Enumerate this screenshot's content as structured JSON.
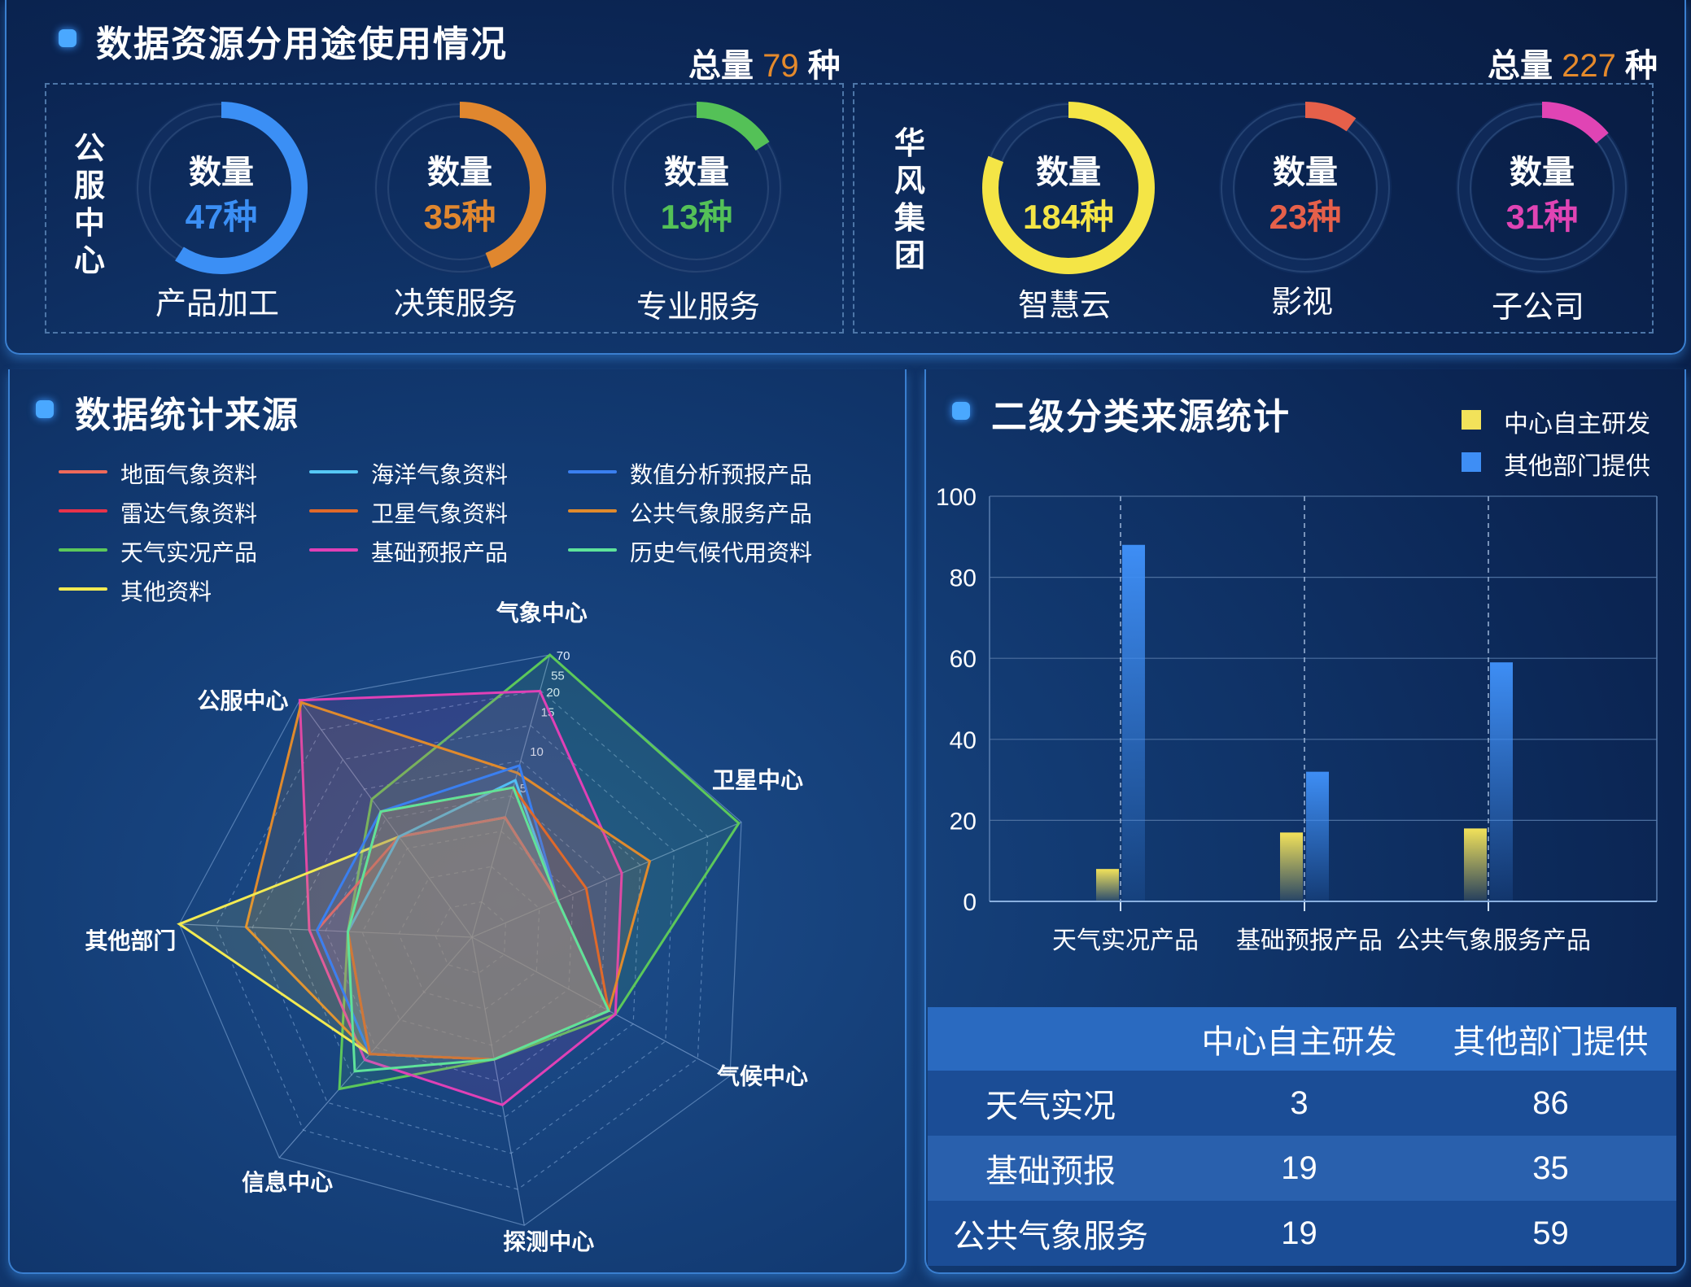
{
  "top": {
    "title": "数据资源分用途使用情况",
    "groups": [
      {
        "name": "公服中心",
        "total_label": "总量",
        "total_value": "79",
        "total_unit": "种",
        "items": [
          {
            "caption": "数量",
            "value": "47种",
            "name": "产品加工",
            "color": "#3b8ff5",
            "fraction": 0.59
          },
          {
            "caption": "数量",
            "value": "35种",
            "name": "决策服务",
            "color": "#e0872f",
            "fraction": 0.44
          },
          {
            "caption": "数量",
            "value": "13种",
            "name": "专业服务",
            "color": "#54c157",
            "fraction": 0.16
          }
        ]
      },
      {
        "name": "华风集团",
        "total_label": "总量",
        "total_value": "227",
        "total_unit": "种",
        "items": [
          {
            "caption": "数量",
            "value": "184种",
            "name": "智慧云",
            "color": "#f4e546",
            "fraction": 0.81
          },
          {
            "caption": "数量",
            "value": "23种",
            "name": "影视",
            "color": "#e6604a",
            "fraction": 0.1
          },
          {
            "caption": "数量",
            "value": "31种",
            "name": "子公司",
            "color": "#e044b4",
            "fraction": 0.14
          }
        ]
      }
    ]
  },
  "radar": {
    "title": "数据统计来源",
    "legend": [
      {
        "name": "地面气象资料",
        "color": "#ef6a5a"
      },
      {
        "name": "海洋气象资料",
        "color": "#56c8f5"
      },
      {
        "name": "数值分析预报产品",
        "color": "#3a7ff0"
      },
      {
        "name": "雷达气象资料",
        "color": "#e8324a"
      },
      {
        "name": "卫星气象资料",
        "color": "#e0692a"
      },
      {
        "name": "公共气象服务产品",
        "color": "#e08a2c"
      },
      {
        "name": "天气实况产品",
        "color": "#5cc85a"
      },
      {
        "name": "基础预报产品",
        "color": "#e040b6"
      },
      {
        "name": "历史气候代用资料",
        "color": "#5ee39a"
      },
      {
        "name": "其他资料",
        "color": "#f2ea52"
      }
    ],
    "ticks": [
      "70",
      "55",
      "20",
      "15",
      "10",
      "5"
    ]
  },
  "chart_data": [
    {
      "type": "radar",
      "title": "数据统计来源",
      "axes": [
        "气象中心",
        "卫星中心",
        "气候中心",
        "探测中心",
        "信息中心",
        "其他部门",
        "公服中心"
      ],
      "max": 70,
      "series": [
        {
          "name": "地面气象资料",
          "values": [
            4,
            3,
            5,
            4,
            5,
            5,
            4
          ]
        },
        {
          "name": "海洋气象资料",
          "values": [
            6,
            3,
            5,
            4,
            5,
            4,
            4
          ]
        },
        {
          "name": "数值分析预报产品",
          "values": [
            8,
            3,
            5,
            4,
            5,
            5,
            5
          ]
        },
        {
          "name": "雷达气象资料",
          "values": [
            5,
            3,
            5,
            4,
            5,
            4,
            5
          ]
        },
        {
          "name": "卫星气象资料",
          "values": [
            5,
            4,
            5,
            4,
            5,
            4,
            5
          ]
        },
        {
          "name": "公共气象服务产品",
          "values": [
            7,
            10,
            5,
            4,
            5,
            14,
            68
          ]
        },
        {
          "name": "天气实况产品",
          "values": [
            70,
            68,
            6,
            4,
            11,
            4,
            7
          ]
        },
        {
          "name": "基础预报产品",
          "values": [
            21,
            6,
            6,
            7,
            6,
            6,
            70
          ]
        },
        {
          "name": "历史气候代用资料",
          "values": [
            5,
            3,
            5,
            4,
            8,
            4,
            5
          ]
        },
        {
          "name": "其他资料",
          "values": [
            4,
            3,
            5,
            4,
            5,
            70,
            4
          ]
        }
      ]
    },
    {
      "type": "bar",
      "title": "二级分类来源统计",
      "categories": [
        "天气实况产品",
        "基础预报产品",
        "公共气象服务产品"
      ],
      "series": [
        {
          "name": "中心自主研发",
          "values": [
            8,
            17,
            18
          ],
          "color": "#f2e25a"
        },
        {
          "name": "其他部门提供",
          "values": [
            88,
            32,
            59
          ],
          "color": "#3e8ef5"
        }
      ],
      "ylim": [
        0,
        100
      ],
      "yticks": [
        "0",
        "20",
        "40",
        "60",
        "80",
        "100"
      ]
    }
  ],
  "table": {
    "headers": [
      "",
      "中心自主研发",
      "其他部门提供"
    ],
    "rows": [
      {
        "label": "天气实况",
        "a": "3",
        "b": "86"
      },
      {
        "label": "基础预报",
        "a": "19",
        "b": "35"
      },
      {
        "label": "公共气象服务",
        "a": "19",
        "b": "59"
      }
    ]
  }
}
